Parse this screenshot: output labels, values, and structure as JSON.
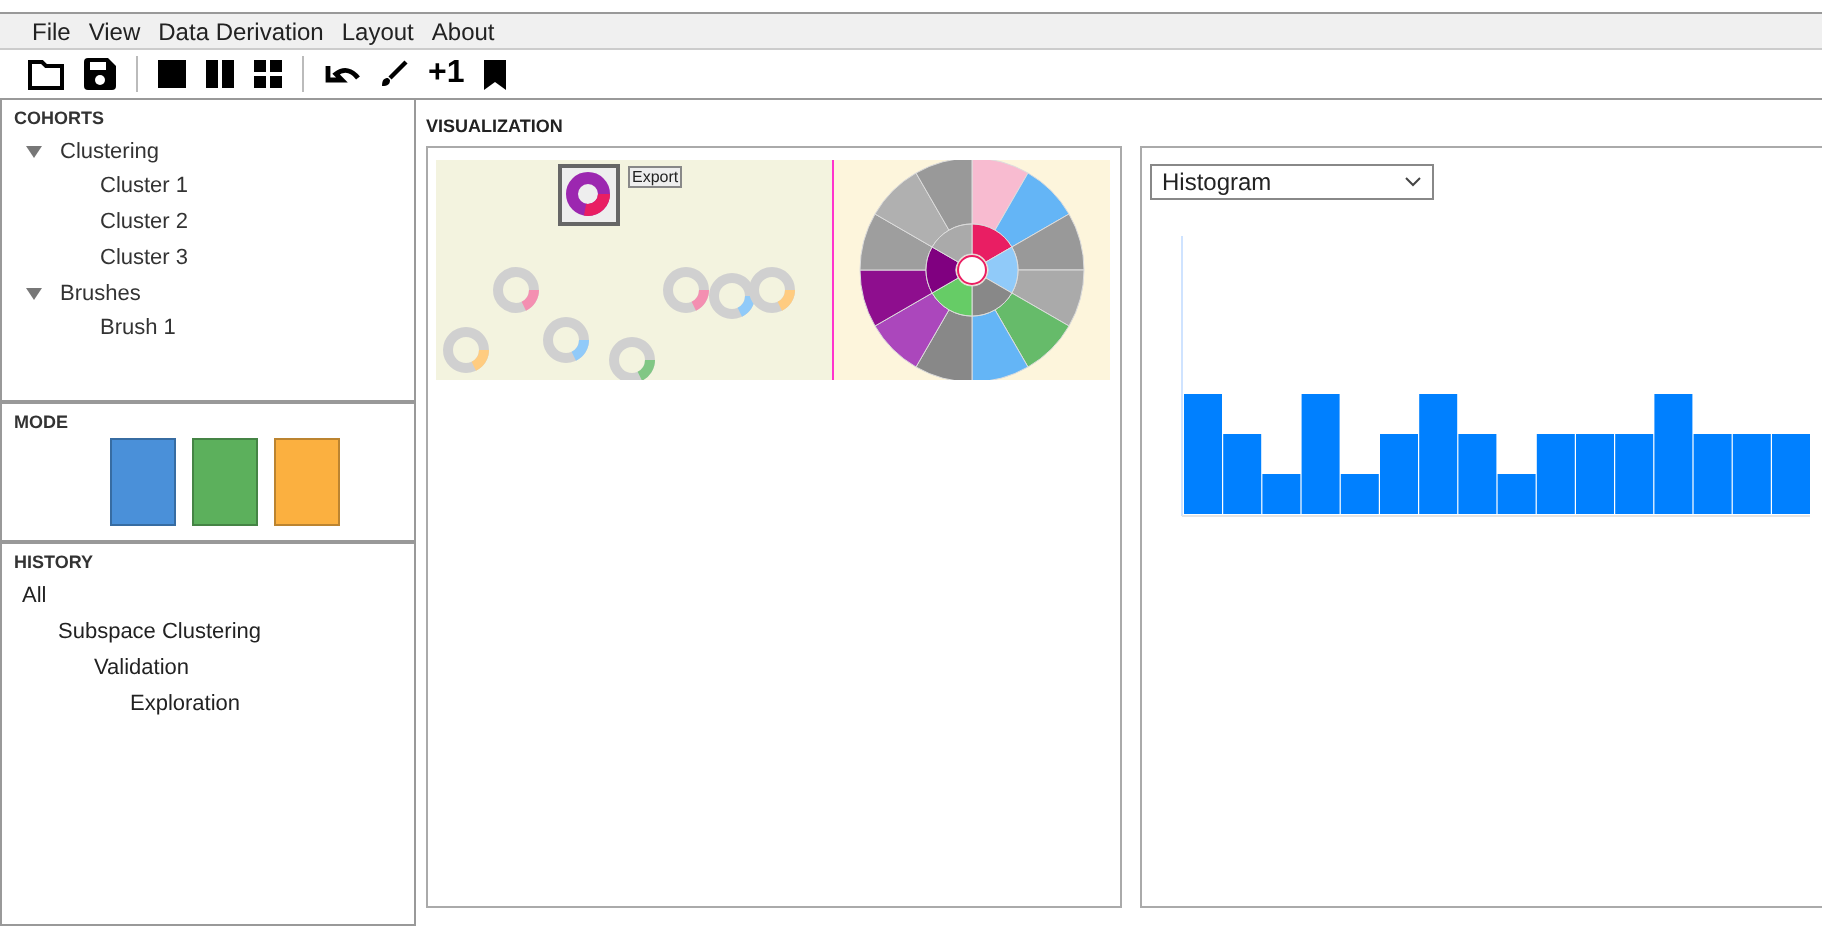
{
  "menu": [
    "File",
    "View",
    "Data Derivation",
    "Layout",
    "About"
  ],
  "toolbar": {
    "counter": "+1"
  },
  "cohorts": {
    "title": "COHORTS",
    "items": [
      {
        "label": "Clustering",
        "expanded": true,
        "children": [
          {
            "label": "Cluster 1"
          },
          {
            "label": "Cluster 2"
          },
          {
            "label": "Cluster 3"
          }
        ]
      },
      {
        "label": "Brushes",
        "expanded": true,
        "children": [
          {
            "label": "Brush 1"
          }
        ]
      }
    ]
  },
  "mode": {
    "title": "MODE",
    "swatches": [
      {
        "color": "#4a90d9"
      },
      {
        "color": "#5cb05c"
      },
      {
        "color": "#fbb040"
      }
    ]
  },
  "history": {
    "title": "HISTORY",
    "items": [
      {
        "label": "All",
        "children": [
          {
            "label": "Subspace Clustering",
            "children": [
              {
                "label": "Validation",
                "children": [
                  {
                    "label": "Exploration"
                  }
                ]
              }
            ]
          }
        ]
      }
    ]
  },
  "visualization": {
    "title": "VISUALIZATION",
    "export_label": "Export",
    "chart_select": "Histogram"
  }
}
